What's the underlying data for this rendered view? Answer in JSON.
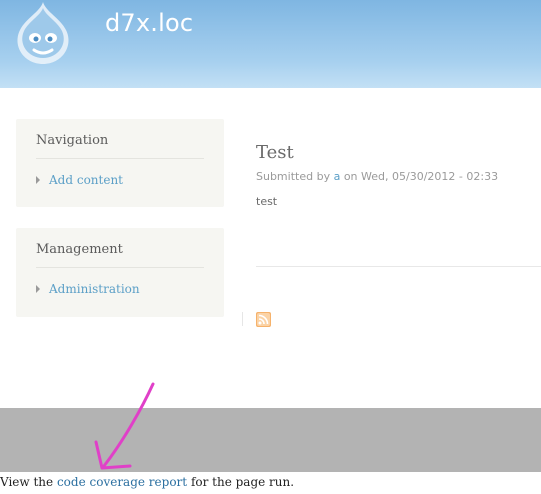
{
  "header": {
    "site_name": "d7x.loc",
    "logo_icon": "drupal-drop-icon"
  },
  "sidebar": {
    "blocks": [
      {
        "title": "Navigation",
        "links": [
          "Add content"
        ]
      },
      {
        "title": "Management",
        "links": [
          "Administration"
        ]
      }
    ]
  },
  "node": {
    "title": "Test",
    "submitted_prefix": "Submitted by ",
    "author": "a",
    "submitted_suffix": " on Wed, 05/30/2012 - 02:33",
    "body": "test"
  },
  "feed": {
    "icon": "rss-feed-icon"
  },
  "footer": {
    "prefix": "View the ",
    "link": "code coverage report",
    "suffix": " for the page run."
  },
  "colors": {
    "header_top": "#7fb6e2",
    "link": "#5b9fc7",
    "arrow": "#e040c8",
    "footer_band": "#b3b3b3"
  }
}
